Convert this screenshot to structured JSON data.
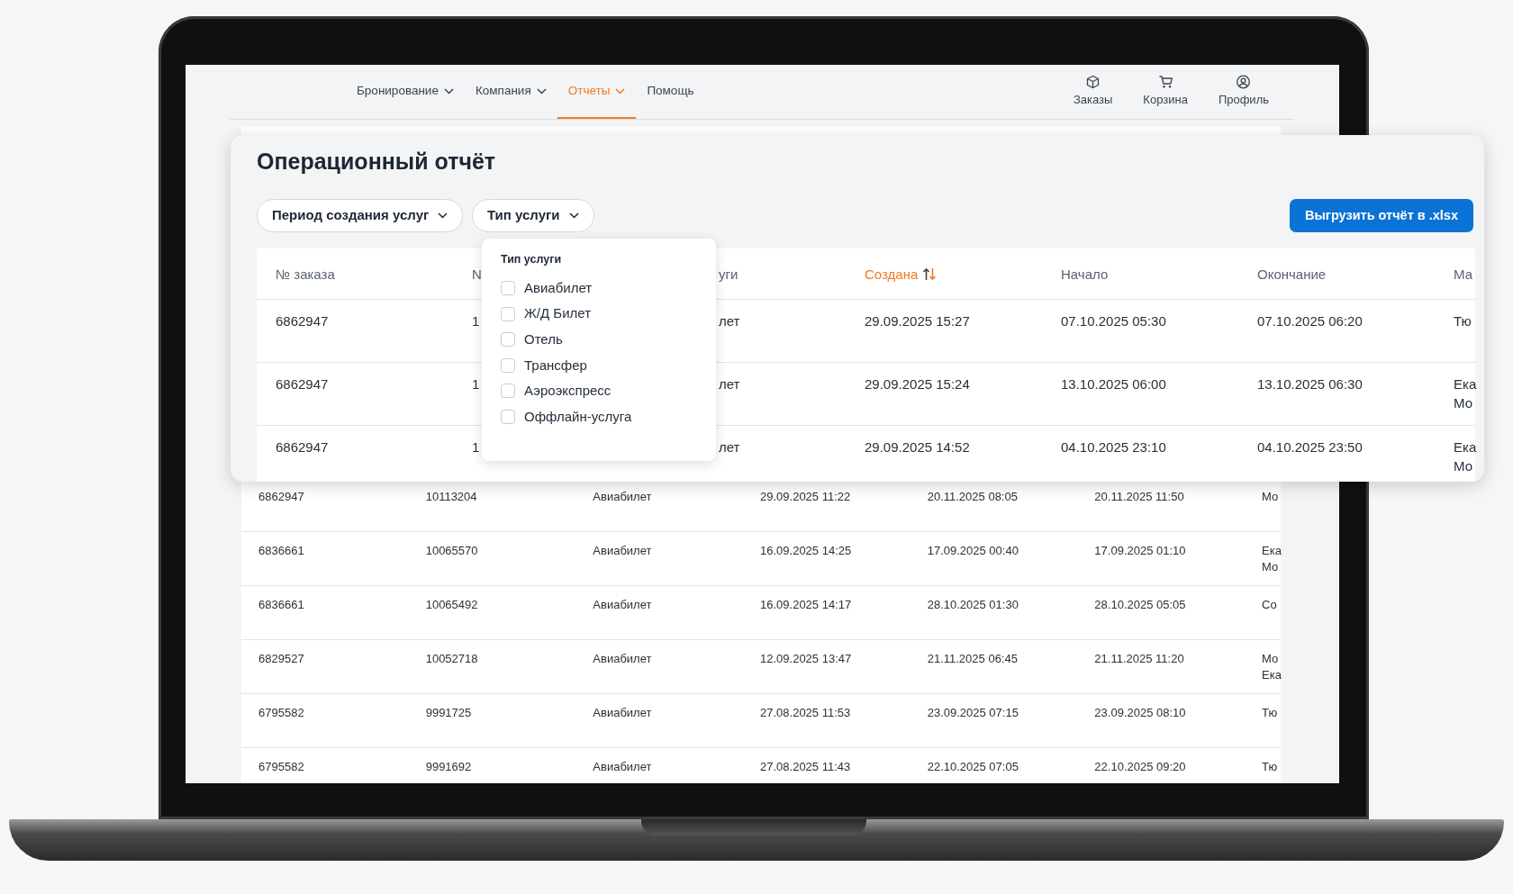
{
  "nav": {
    "items": [
      {
        "label": "Бронирование",
        "selected": false,
        "has_menu": true
      },
      {
        "label": "Компания",
        "selected": false,
        "has_menu": true
      },
      {
        "label": "Отчеты",
        "selected": true,
        "has_menu": true
      },
      {
        "label": "Помощь",
        "selected": false,
        "has_menu": false
      }
    ],
    "actions": [
      {
        "label": "Заказы",
        "kind": "orders"
      },
      {
        "label": "Корзина",
        "kind": "cart"
      },
      {
        "label": "Профиль",
        "kind": "profile"
      }
    ]
  },
  "report": {
    "title": "Операционный отчёт",
    "filters": [
      {
        "label": "Период создания услуг"
      },
      {
        "label": "Тип услуги"
      }
    ],
    "export_button": "Выгрузить отчёт в .xlsx",
    "columns": [
      {
        "label": "№ заказа",
        "sorted": false
      },
      {
        "label": "N",
        "sorted": false
      },
      {
        "label": "уги",
        "sorted": false
      },
      {
        "label": "Создана",
        "sorted": true
      },
      {
        "label": "Начало",
        "sorted": false
      },
      {
        "label": "Окончание",
        "sorted": false
      },
      {
        "label": "Ма",
        "sorted": false
      }
    ],
    "rows": [
      [
        "6862947",
        "1",
        "лет",
        "29.09.2025 15:27",
        "07.10.2025 05:30",
        "07.10.2025 06:20",
        "Тю"
      ],
      [
        "6862947",
        "1",
        "лет",
        "29.09.2025 15:24",
        "13.10.2025 06:00",
        "13.10.2025 06:30",
        "Ека\nМо"
      ],
      [
        "6862947",
        "1",
        "лет",
        "29.09.2025 14:52",
        "04.10.2025 23:10",
        "04.10.2025 23:50",
        "Ека\nМо"
      ]
    ]
  },
  "service_type_menu": {
    "title": "Тип услуги",
    "options": [
      {
        "label": "Авиабилет",
        "checked": false
      },
      {
        "label": "Ж/Д Билет",
        "checked": false
      },
      {
        "label": "Отель",
        "checked": false
      },
      {
        "label": "Трансфер",
        "checked": false
      },
      {
        "label": "Аэроэкспресс",
        "checked": false
      },
      {
        "label": "Оффлайн-услуга",
        "checked": false
      }
    ]
  },
  "background_table": {
    "rows": [
      [
        "6862947",
        "10113204",
        "Авиабилет",
        "29.09.2025 11:22",
        "20.11.2025 08:05",
        "20.11.2025 11:50",
        "Мо"
      ],
      [
        "6836661",
        "10065570",
        "Авиабилет",
        "16.09.2025 14:25",
        "17.09.2025 00:40",
        "17.09.2025 01:10",
        "Ека\nМо"
      ],
      [
        "6836661",
        "10065492",
        "Авиабилет",
        "16.09.2025 14:17",
        "28.10.2025 01:30",
        "28.10.2025 05:05",
        "Со"
      ],
      [
        "6829527",
        "10052718",
        "Авиабилет",
        "12.09.2025 13:47",
        "21.11.2025 06:45",
        "21.11.2025 11:20",
        "Мо\nЕка"
      ],
      [
        "6795582",
        "9991725",
        "Авиабилет",
        "27.08.2025 11:53",
        "23.09.2025 07:15",
        "23.09.2025 08:10",
        "Тю"
      ],
      [
        "6795582",
        "9991692",
        "Авиабилет",
        "27.08.2025 11:43",
        "22.10.2025 07:05",
        "22.10.2025 09:20",
        "Тю"
      ]
    ]
  }
}
